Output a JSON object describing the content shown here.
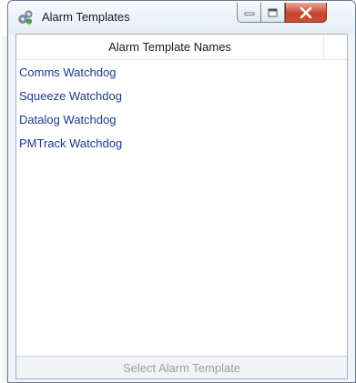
{
  "window": {
    "title": "Alarm Templates",
    "controls": {
      "minimize_icon": "minimize-icon",
      "maximize_icon": "maximize-icon",
      "close_icon": "close-icon"
    }
  },
  "table": {
    "column_header": "Alarm Template Names",
    "rows": [
      "Comms Watchdog",
      "Squeeze Watchdog",
      "Datalog Watchdog",
      "PMTrack Watchdog"
    ]
  },
  "footer": {
    "select_button_label": "Select Alarm Template",
    "select_button_enabled": false
  },
  "colors": {
    "row_text": "#1d3a8a",
    "disabled_text": "#9aa0a8",
    "close_red": "#c8442d"
  }
}
